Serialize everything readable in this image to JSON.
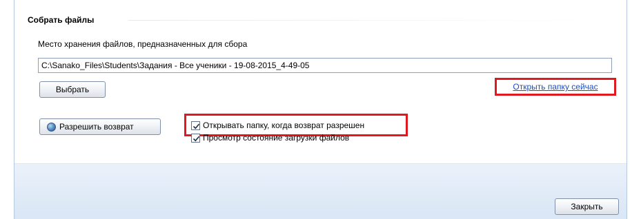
{
  "section": {
    "title": "Собрать файлы"
  },
  "storage": {
    "label": "Место хранения файлов, предназначенных для сбора",
    "path_value": "C:\\Sanako_Files\\Students\\Задания - Все ученики - 19-08-2015_4-49-05"
  },
  "buttons": {
    "choose_label": "Выбрать",
    "allow_return_label": "Разрешить возврат",
    "close_label": "Закрыть"
  },
  "links": {
    "open_folder_now": "Открыть папку сейчас"
  },
  "options": [
    {
      "label": "Открывать папку, когда возврат разрешен",
      "checked": true
    },
    {
      "label": "Просмотр состояние загрузки файлов",
      "checked": true
    }
  ],
  "colors": {
    "highlight": "#e0191e",
    "link": "#1b4fc1"
  }
}
